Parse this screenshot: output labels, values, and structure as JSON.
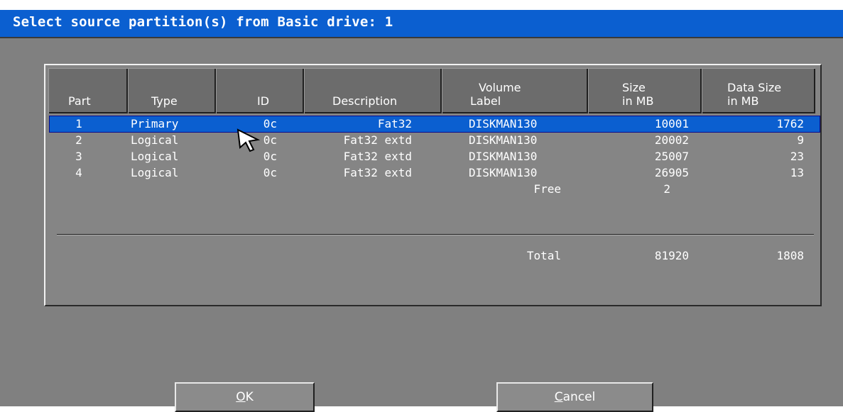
{
  "dialog": {
    "title": "Select source partition(s) from Basic drive: 1"
  },
  "table": {
    "headers": {
      "part": [
        "Part"
      ],
      "type": [
        "Type"
      ],
      "id": [
        "ID"
      ],
      "description": [
        "Description"
      ],
      "volume_label": [
        "Volume",
        "Label"
      ],
      "size": [
        "Size",
        "in MB"
      ],
      "data_size": [
        "Data Size",
        "in MB"
      ]
    },
    "rows": [
      {
        "part": "1",
        "type": "Primary",
        "id": "0c",
        "description": "Fat32",
        "volume_label": "DISKMAN130",
        "size": "10001",
        "data_size": "1762",
        "selected": true
      },
      {
        "part": "2",
        "type": "Logical",
        "id": "0c",
        "description": "Fat32 extd",
        "volume_label": "DISKMAN130",
        "size": "20002",
        "data_size": "9",
        "selected": false
      },
      {
        "part": "3",
        "type": "Logical",
        "id": "0c",
        "description": "Fat32 extd",
        "volume_label": "DISKMAN130",
        "size": "25007",
        "data_size": "23",
        "selected": false
      },
      {
        "part": "4",
        "type": "Logical",
        "id": "0c",
        "description": "Fat32 extd",
        "volume_label": "DISKMAN130",
        "size": "26905",
        "data_size": "13",
        "selected": false
      }
    ],
    "free": {
      "label": "Free",
      "size": "2"
    },
    "total": {
      "label": "Total",
      "size": "81920",
      "data_size": "1808"
    }
  },
  "buttons": {
    "ok": {
      "mnemonic": "O",
      "rest": "K"
    },
    "cancel": {
      "mnemonic": "C",
      "rest": "ancel"
    }
  },
  "colors": {
    "titlebar": "#0b5fd0",
    "selection": "#0b5fd0",
    "dialog_bg": "#808080"
  }
}
